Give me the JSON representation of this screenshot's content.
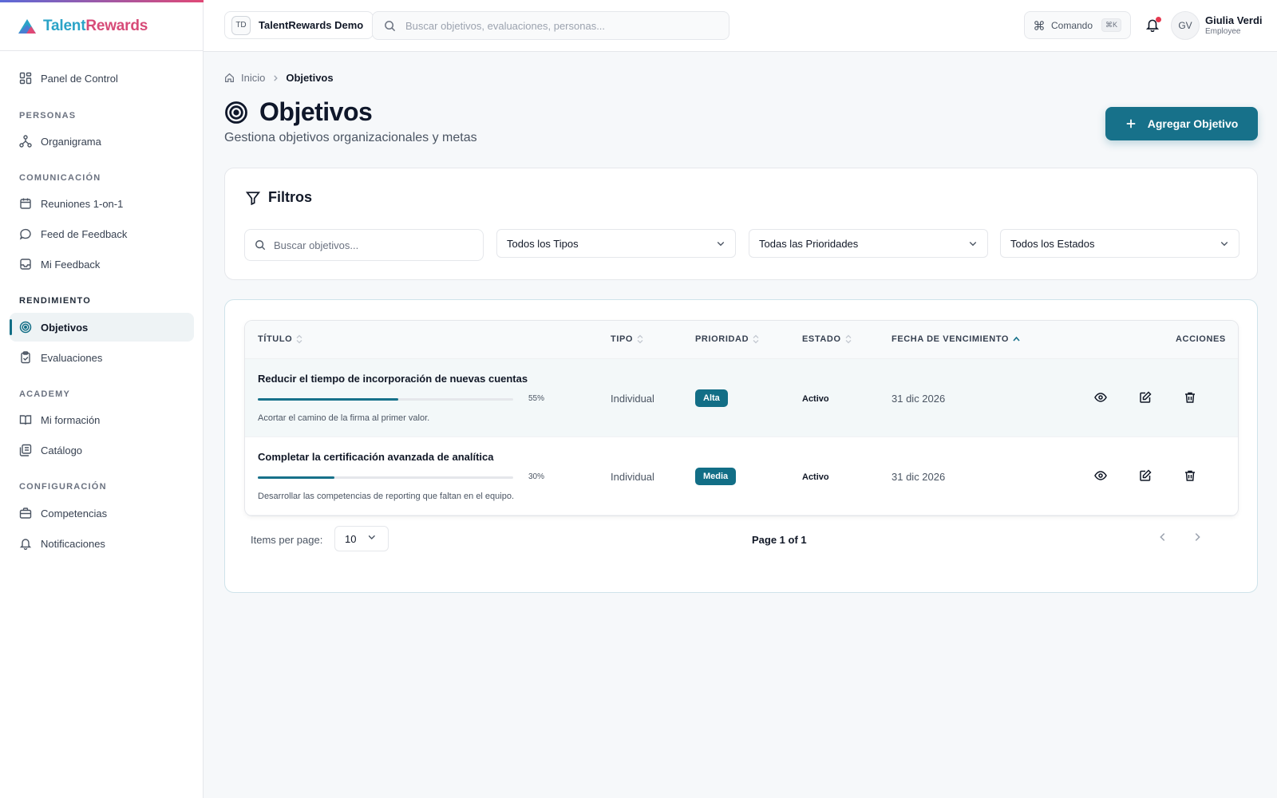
{
  "app": {
    "logo": {
      "part1": "Talent",
      "part2": "Rewards"
    }
  },
  "topbar": {
    "workspace_badge": "TD",
    "workspace_name": "TalentRewards Demo",
    "search_placeholder": "Buscar objetivos, evaluaciones, personas...",
    "command_label": "Comando",
    "command_shortcut": "⌘K",
    "user_initials": "GV",
    "user_name": "Giulia Verdi",
    "user_role": "Employee"
  },
  "sidebar": {
    "dashboard": "Panel de Control",
    "sections": {
      "people": "PERSONAS",
      "communication": "COMUNICACIÓN",
      "performance": "RENDIMIENTO",
      "academy": "ACADEMY",
      "settings": "CONFIGURACIÓN"
    },
    "items": {
      "orgchart": "Organigrama",
      "meetings": "Reuniones 1-on-1",
      "feedback_feed": "Feed de Feedback",
      "my_feedback": "Mi Feedback",
      "objectives": "Objetivos",
      "evaluations": "Evaluaciones",
      "my_training": "Mi formación",
      "catalog": "Catálogo",
      "competencies": "Competencias",
      "notifications": "Notificaciones"
    },
    "active_item": "objectives"
  },
  "breadcrumb": {
    "home": "Inicio",
    "current": "Objetivos"
  },
  "page": {
    "title": "Objetivos",
    "subtitle": "Gestiona objetivos organizacionales y metas",
    "add_button": "Agregar Objetivo"
  },
  "filters": {
    "title": "Filtros",
    "search_placeholder": "Buscar objetivos...",
    "type_select": "Todos los Tipos",
    "priority_select": "Todas las Prioridades",
    "status_select": "Todos los Estados"
  },
  "table": {
    "headers": {
      "title": "TÍTULO",
      "type": "TIPO",
      "priority": "PRIORIDAD",
      "status": "ESTADO",
      "due_date": "FECHA DE VENCIMIENTO",
      "actions": "ACCIONES"
    },
    "rows": [
      {
        "title": "Reducir el tiempo de incorporación de nuevas cuentas",
        "progress": 55,
        "progress_label": "55%",
        "description": "Acortar el camino de la firma al primer valor.",
        "type": "Individual",
        "priority": "Alta",
        "status": "Activo",
        "due_date": "31 dic 2026"
      },
      {
        "title": "Completar la certificación avanzada de analítica",
        "progress": 30,
        "progress_label": "30%",
        "description": "Desarrollar las competencias de reporting que faltan en el equipo.",
        "type": "Individual",
        "priority": "Media",
        "status": "Activo",
        "due_date": "31 dic 2026"
      }
    ]
  },
  "pagination": {
    "items_per_page_label": "Items per page:",
    "items_per_page_value": "10",
    "page_info": "Page 1 of 1"
  },
  "colors": {
    "accent": "#126e86",
    "brand_blue": "#2aa3c7",
    "brand_pink": "#d74b78",
    "notification_dot": "#e53950"
  }
}
